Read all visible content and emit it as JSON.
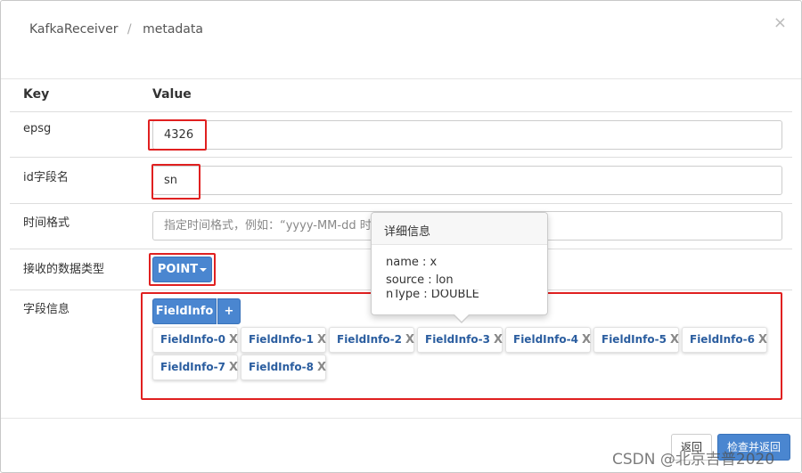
{
  "header": {
    "breadcrumb_root": "KafkaReceiver",
    "breadcrumb_separator": "/",
    "breadcrumb_current": "metadata",
    "close_symbol": "×"
  },
  "table": {
    "key_header": "Key",
    "value_header": "Value"
  },
  "rows": {
    "epsg": {
      "key": "epsg",
      "value": "4326"
    },
    "id_field": {
      "key": "id字段名",
      "value": "sn"
    },
    "time_format": {
      "key": "时间格式",
      "placeholder": "指定时间格式，例如：“yyyy-MM-dd 时-分-秒” 。"
    },
    "data_type": {
      "key": "接收的数据类型",
      "selected": "POINT"
    },
    "field_info": {
      "key": "字段信息",
      "group_label": "FieldInfo",
      "add_label": "+",
      "remove_symbol": "X",
      "chips": [
        "FieldInfo-0",
        "FieldInfo-1",
        "FieldInfo-2",
        "FieldInfo-3",
        "FieldInfo-4",
        "FieldInfo-5",
        "FieldInfo-6",
        "FieldInfo-7",
        "FieldInfo-8"
      ]
    }
  },
  "popover": {
    "title": "详细信息",
    "lines": [
      "name : x",
      "source : lon",
      "nType : DOUBLE"
    ]
  },
  "footer": {
    "back_label": "返回",
    "check_return_label": "检查并返回"
  },
  "watermark": "CSDN @北京吉普2020",
  "colors": {
    "accent": "#4a86d0",
    "highlight_box": "#e02020",
    "chip_text": "#2a5d9f"
  }
}
